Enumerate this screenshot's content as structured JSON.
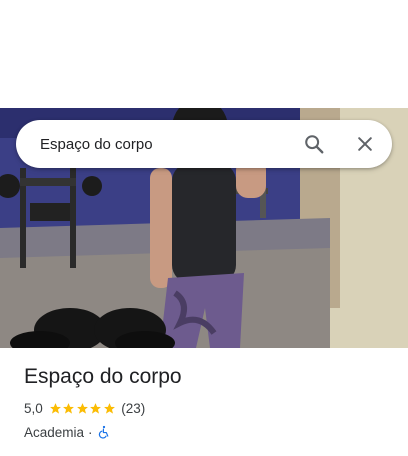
{
  "search": {
    "value": "Espaço do corpo",
    "search_icon": "search-icon",
    "close_icon": "close-icon"
  },
  "photo": {
    "description_icon": "gym-photo"
  },
  "place": {
    "name": "Espaço do corpo",
    "rating": "5,0",
    "stars": 5,
    "reviews": "(23)",
    "category": "Academia",
    "separator": "·",
    "accessibility_icon": "wheelchair-icon"
  },
  "colors": {
    "star": "#fbbc04",
    "accessibility": "#1a73e8",
    "text_primary": "#202124",
    "text_secondary": "#3c4043",
    "icon_gray": "#5f6368"
  }
}
